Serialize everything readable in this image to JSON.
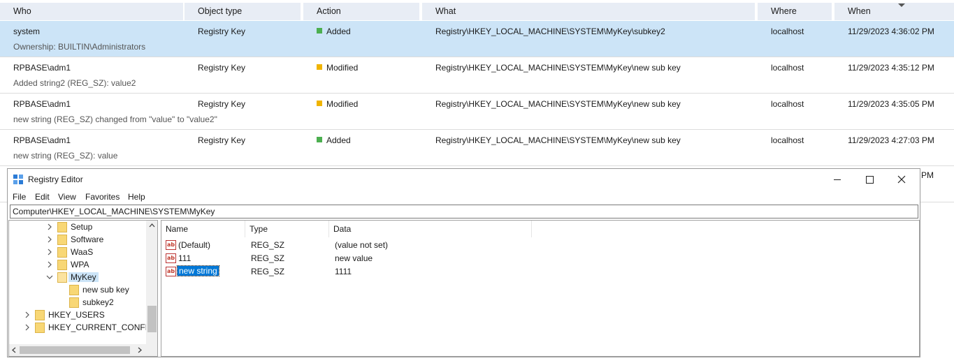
{
  "audit": {
    "columns": [
      {
        "key": "who",
        "label": "Who"
      },
      {
        "key": "object_type",
        "label": "Object type"
      },
      {
        "key": "action",
        "label": "Action"
      },
      {
        "key": "what",
        "label": "What"
      },
      {
        "key": "where",
        "label": "Where"
      },
      {
        "key": "when",
        "label": "When"
      }
    ],
    "rows": [
      {
        "who": "system",
        "detail": "Ownership: BUILTIN\\Administrators",
        "object_type": "Registry Key",
        "action": "Added",
        "action_color": "#4caf50",
        "what": "Registry\\HKEY_LOCAL_MACHINE\\SYSTEM\\MyKey\\subkey2",
        "where": "localhost",
        "when": "11/29/2023 4:36:02 PM",
        "selected": true
      },
      {
        "who": "RPBASE\\adm1",
        "detail": "Added string2 (REG_SZ): value2",
        "object_type": "Registry Key",
        "action": "Modified",
        "action_color": "#f0b400",
        "what": "Registry\\HKEY_LOCAL_MACHINE\\SYSTEM\\MyKey\\new sub key",
        "where": "localhost",
        "when": "11/29/2023 4:35:12 PM",
        "selected": false
      },
      {
        "who": "RPBASE\\adm1",
        "detail": "new string (REG_SZ) changed from \"value\" to \"value2\"",
        "object_type": "Registry Key",
        "action": "Modified",
        "action_color": "#f0b400",
        "what": "Registry\\HKEY_LOCAL_MACHINE\\SYSTEM\\MyKey\\new sub key",
        "where": "localhost",
        "when": "11/29/2023 4:35:05 PM",
        "selected": false
      },
      {
        "who": "RPBASE\\adm1",
        "detail": "new string (REG_SZ): value",
        "object_type": "Registry Key",
        "action": "Added",
        "action_color": "#4caf50",
        "what": "Registry\\HKEY_LOCAL_MACHINE\\SYSTEM\\MyKey\\new sub key",
        "where": "localhost",
        "when": "11/29/2023 4:27:03 PM",
        "selected": false
      }
    ],
    "partial_row_when": "PM"
  },
  "regedit": {
    "title": "Registry Editor",
    "menu": [
      "File",
      "Edit",
      "View",
      "Favorites",
      "Help"
    ],
    "address": "Computer\\HKEY_LOCAL_MACHINE\\SYSTEM\\MyKey",
    "tree": [
      {
        "label": "Setup",
        "indent": 1,
        "expander": "collapsed",
        "selected": false,
        "open": false
      },
      {
        "label": "Software",
        "indent": 1,
        "expander": "collapsed",
        "selected": false,
        "open": false
      },
      {
        "label": "WaaS",
        "indent": 1,
        "expander": "collapsed",
        "selected": false,
        "open": false
      },
      {
        "label": "WPA",
        "indent": 1,
        "expander": "collapsed",
        "selected": false,
        "open": false
      },
      {
        "label": "MyKey",
        "indent": 1,
        "expander": "expanded",
        "selected": true,
        "open": true
      },
      {
        "label": "new sub key",
        "indent": 2,
        "expander": "none",
        "selected": false,
        "open": false
      },
      {
        "label": "subkey2",
        "indent": 2,
        "expander": "none",
        "selected": false,
        "open": false
      },
      {
        "label": "HKEY_USERS",
        "indent": 0,
        "expander": "collapsed",
        "selected": false,
        "open": false
      },
      {
        "label": "HKEY_CURRENT_CONFIG",
        "indent": 0,
        "expander": "collapsed",
        "selected": false,
        "open": false
      }
    ],
    "list_columns": [
      {
        "label": "Name"
      },
      {
        "label": "Type"
      },
      {
        "label": "Data"
      }
    ],
    "values": [
      {
        "icon": "ab",
        "name": "(Default)",
        "type": "REG_SZ",
        "data": "(value not set)",
        "editing": false
      },
      {
        "icon": "ab",
        "name": "111",
        "type": "REG_SZ",
        "data": "new value",
        "editing": false
      },
      {
        "icon": "ab",
        "name": "new string",
        "type": "REG_SZ",
        "data": "1111",
        "editing": true
      }
    ]
  }
}
